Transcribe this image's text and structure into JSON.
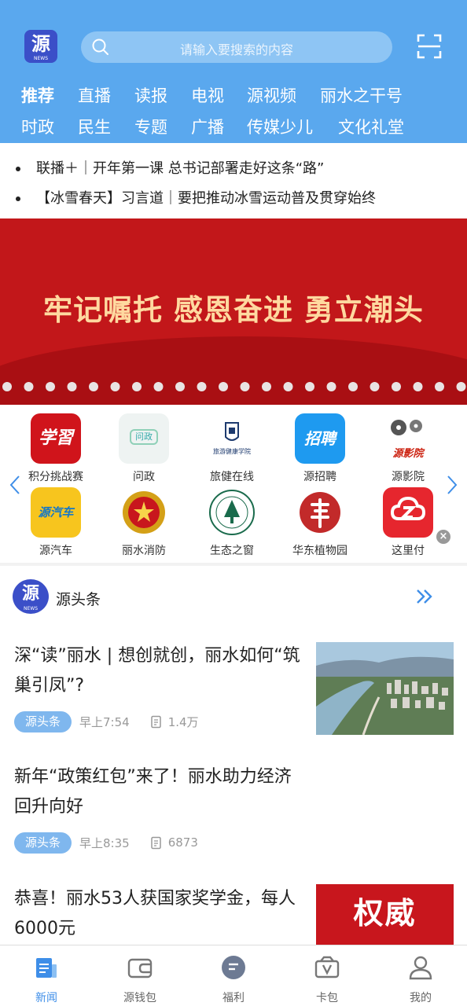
{
  "header": {
    "logo_text": "源",
    "logo_sub": "NEWS",
    "search_placeholder": "请输入要搜索的内容",
    "tabs_row1": [
      "推荐",
      "直播",
      "读报",
      "电视",
      "源视频",
      "丽水之干号"
    ],
    "tabs_row2": [
      "时政",
      "民生",
      "专题",
      "广播",
      "传媒少儿",
      "文化礼堂"
    ],
    "active_tab": "推荐"
  },
  "headlines": [
    "联播＋｜开年第一课 总书记部署走好这条“路”",
    "【冰雪春天】习言道｜要把推动冰雪运动普及贯穿始终"
  ],
  "banner": {
    "title": "牢记嘱托  感恩奋进  勇立潮头"
  },
  "apps": [
    {
      "label": "积分挑战赛",
      "icon": "xuexi-icon",
      "color": "#d0141b",
      "glyph": "学習"
    },
    {
      "label": "问政",
      "icon": "wenzheng-icon",
      "color": "#eef3f2",
      "glyph": "问政"
    },
    {
      "label": "旅健在线",
      "icon": "university-badge-icon",
      "color": "#ffffff",
      "glyph": "旅游健康学院"
    },
    {
      "label": "源招聘",
      "icon": "recruit-icon",
      "color": "#1e9af0",
      "glyph": "招聘"
    },
    {
      "label": "源影院",
      "icon": "cinema-icon",
      "color": "#ffffff",
      "glyph": "源影院"
    },
    {
      "label": "源汽车",
      "icon": "car-icon",
      "color": "#f7c51e",
      "glyph": "源汽车"
    },
    {
      "label": "丽水消防",
      "icon": "fire-emblem-icon",
      "color": "#ffffff",
      "glyph": ""
    },
    {
      "label": "生态之窗",
      "icon": "ecology-badge-icon",
      "color": "#ffffff",
      "glyph": ""
    },
    {
      "label": "华东植物园",
      "icon": "botanical-seal-icon",
      "color": "#ffffff",
      "glyph": ""
    },
    {
      "label": "这里付",
      "icon": "pay-icon",
      "color": "#e6262e",
      "glyph": ""
    }
  ],
  "section": {
    "title": "源头条",
    "logo_text": "源",
    "logo_sub": "NEWS"
  },
  "news": [
    {
      "title": "深“读”丽水 | 想创就创，丽水如何“筑巢引凤”?",
      "tag": "源头条",
      "time": "早上7:54",
      "views": "1.4万",
      "thumb": "city-river-photo"
    },
    {
      "title": "新年“政策红包”来了！丽水助力经济回升向好",
      "tag": "源头条",
      "time": "早上8:35",
      "views": "6873",
      "thumb": ""
    },
    {
      "title": "恭喜！丽水53人获国家奖学金，每人6000元",
      "tag": "",
      "time": "",
      "views": "",
      "thumb": "authority-release-image",
      "thumb_text": "权威"
    }
  ],
  "bottom_nav": [
    {
      "label": "新闻",
      "icon": "news-icon",
      "active": true
    },
    {
      "label": "源钱包",
      "icon": "wallet-icon",
      "active": false
    },
    {
      "label": "福利",
      "icon": "welfare-icon",
      "active": false
    },
    {
      "label": "卡包",
      "icon": "card-package-icon",
      "active": false
    },
    {
      "label": "我的",
      "icon": "profile-icon",
      "active": false
    }
  ],
  "colors": {
    "header_bg": "#5aa8ee",
    "accent": "#3e8ee8",
    "banner_bg": "#c2171a",
    "banner_text": "#ffd9a0",
    "tag_bg": "#7fb7ee"
  }
}
